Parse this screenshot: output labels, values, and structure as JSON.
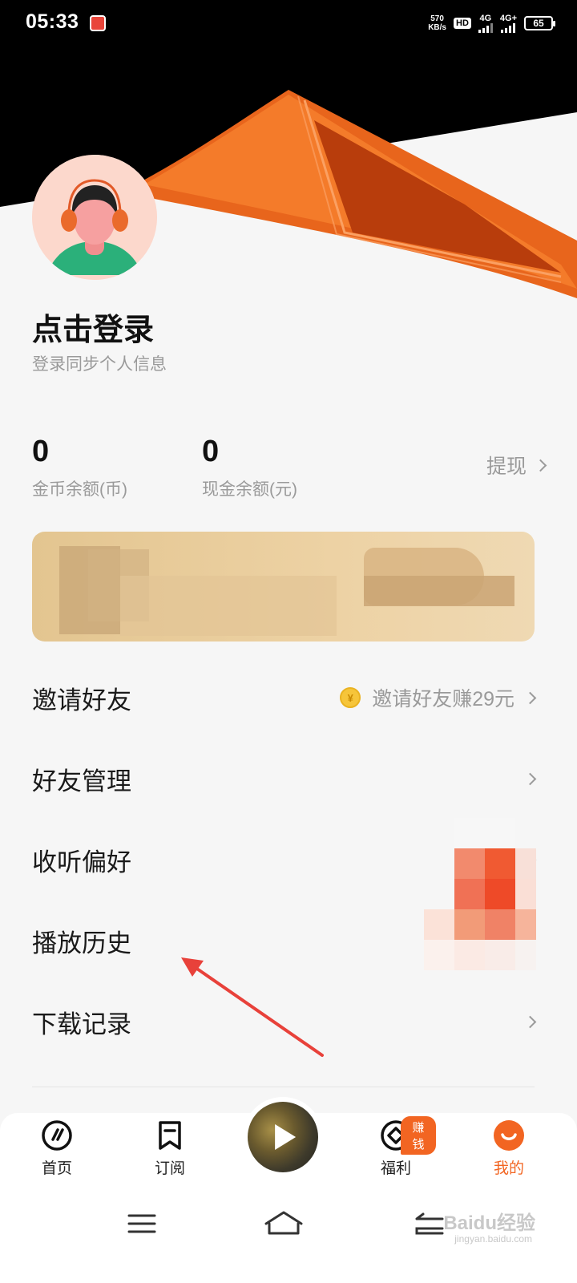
{
  "status_bar": {
    "time": "05:33",
    "net_speed_value": "570",
    "net_speed_unit": "KB/s",
    "hd_label": "HD",
    "sim1_label": "4G",
    "sim2_label": "4G+",
    "battery": "65"
  },
  "profile": {
    "login_title": "点击登录",
    "login_subtitle": "登录同步个人信息"
  },
  "balances": {
    "coins_value": "0",
    "coins_label": "金币余额(币)",
    "cash_value": "0",
    "cash_label": "现金余额(元)",
    "withdraw_label": "提现"
  },
  "menu": {
    "items": [
      {
        "label": "邀请好友",
        "extra": "邀请好友赚29元",
        "coin_symbol": "¥"
      },
      {
        "label": "好友管理"
      },
      {
        "label": "收听偏好"
      },
      {
        "label": "播放历史"
      },
      {
        "label": "下载记录"
      }
    ]
  },
  "bottom_nav": {
    "items": [
      {
        "label": "首页",
        "icon": "home-slash-icon"
      },
      {
        "label": "订阅",
        "icon": "bookmark-icon"
      },
      {
        "label": "福利",
        "icon": "welfare-icon",
        "badge": "赚钱"
      },
      {
        "label": "我的",
        "icon": "me-face-icon",
        "active": true
      }
    ],
    "player_icon": "play-icon"
  },
  "watermark": {
    "brand": "Baidu经验",
    "sub": "jingyan.baidu.com"
  },
  "colors": {
    "accent": "#f26522",
    "background": "#f6f6f6",
    "hero_dark": "#000000",
    "banner": "#e8cc9c",
    "annotation_arrow": "#e8413a"
  }
}
